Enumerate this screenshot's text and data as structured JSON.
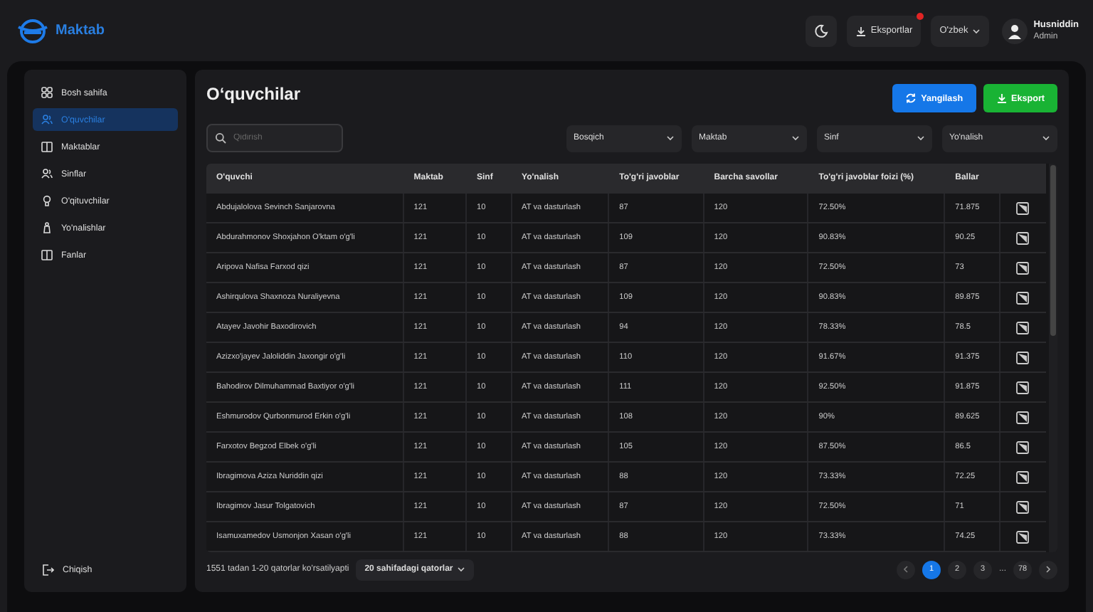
{
  "header": {
    "logo": "Maktab",
    "export_menu": {
      "label": "Eksportlar",
      "notification": true
    },
    "language": "O'zbek",
    "user": {
      "name": "Husniddin",
      "role": "Admin"
    }
  },
  "sidebar": {
    "items": [
      {
        "label": "Bosh sahifa",
        "selected": false
      },
      {
        "label": "O'quvchilar",
        "selected": true
      },
      {
        "label": "Maktablar",
        "selected": false
      },
      {
        "label": "Sinflar",
        "selected": false
      },
      {
        "label": "O'qituvchilar",
        "selected": false
      },
      {
        "label": "Yo'nalishlar",
        "selected": false
      },
      {
        "label": "Fanlar",
        "selected": false
      }
    ],
    "logout": "Chiqish"
  },
  "page": {
    "title": "O‘quvchilar",
    "buttons": [
      "Yangilash",
      "Eksport"
    ]
  },
  "search": {
    "placeholder": "Qidirish"
  },
  "filters": [
    "Bosqich",
    "Maktab",
    "Sinf",
    "Yo'nalish"
  ],
  "table": {
    "columns": [
      "O'quvchi",
      "Maktab",
      "Sinf",
      "Yo'nalish",
      "To'g'ri javoblar",
      "Barcha savollar",
      "To'g'ri javoblar foizi (%)",
      "Ballar"
    ],
    "rows": [
      [
        "Abdujalolova Sevinch Sanjarovna",
        "121",
        "10",
        "AT va dasturlash",
        "87",
        "120",
        "72.50%",
        "71.875"
      ],
      [
        "Abdurahmonov Shoxjahon O'ktam o'g'li",
        "121",
        "10",
        "AT va dasturlash",
        "109",
        "120",
        "90.83%",
        "90.25"
      ],
      [
        "Aripova Nafisa Farxod qizi",
        "121",
        "10",
        "AT va dasturlash",
        "87",
        "120",
        "72.50%",
        "73"
      ],
      [
        "Ashirqulova Shaxnoza Nuraliyevna",
        "121",
        "10",
        "AT va dasturlash",
        "109",
        "120",
        "90.83%",
        "89.875"
      ],
      [
        "Atayev Javohir Baxodirovich",
        "121",
        "10",
        "AT va dasturlash",
        "94",
        "120",
        "78.33%",
        "78.5"
      ],
      [
        "Azizxo'jayev Jaloliddin Jaxongir o'g'li",
        "121",
        "10",
        "AT va dasturlash",
        "110",
        "120",
        "91.67%",
        "91.375"
      ],
      [
        "Bahodirov Dilmuhammad Baxtiyor o'g'li",
        "121",
        "10",
        "AT va dasturlash",
        "111",
        "120",
        "92.50%",
        "91.875"
      ],
      [
        "Eshmurodov Qurbonmurod Erkin o'g'li",
        "121",
        "10",
        "AT va dasturlash",
        "108",
        "120",
        "90%",
        "89.625"
      ],
      [
        "Farxotov Begzod Elbek o'g'li",
        "121",
        "10",
        "AT va dasturlash",
        "105",
        "120",
        "87.50%",
        "86.5"
      ],
      [
        "Ibragimova Aziza Nuriddin qizi",
        "121",
        "10",
        "AT va dasturlash",
        "88",
        "120",
        "73.33%",
        "72.25"
      ],
      [
        "Ibragimov Jasur Tolgatovich",
        "121",
        "10",
        "AT va dasturlash",
        "87",
        "120",
        "72.50%",
        "71"
      ],
      [
        "Isamuxamedov Usmonjon Xasan o'g'li",
        "121",
        "10",
        "AT va dasturlash",
        "88",
        "120",
        "73.33%",
        "74.25"
      ]
    ]
  },
  "footer": {
    "summary": "1551 tadan 1-20 qatorlar ko'rsatilyapti",
    "page_size": "20 sahifadagi qatorlar",
    "pages": [
      {
        "label": "1",
        "selected": true
      },
      {
        "label": "2",
        "selected": false
      },
      {
        "label": "3",
        "selected": false
      },
      {
        "label": "...",
        "kind": "gap"
      },
      {
        "label": "78",
        "selected": false
      }
    ]
  }
}
